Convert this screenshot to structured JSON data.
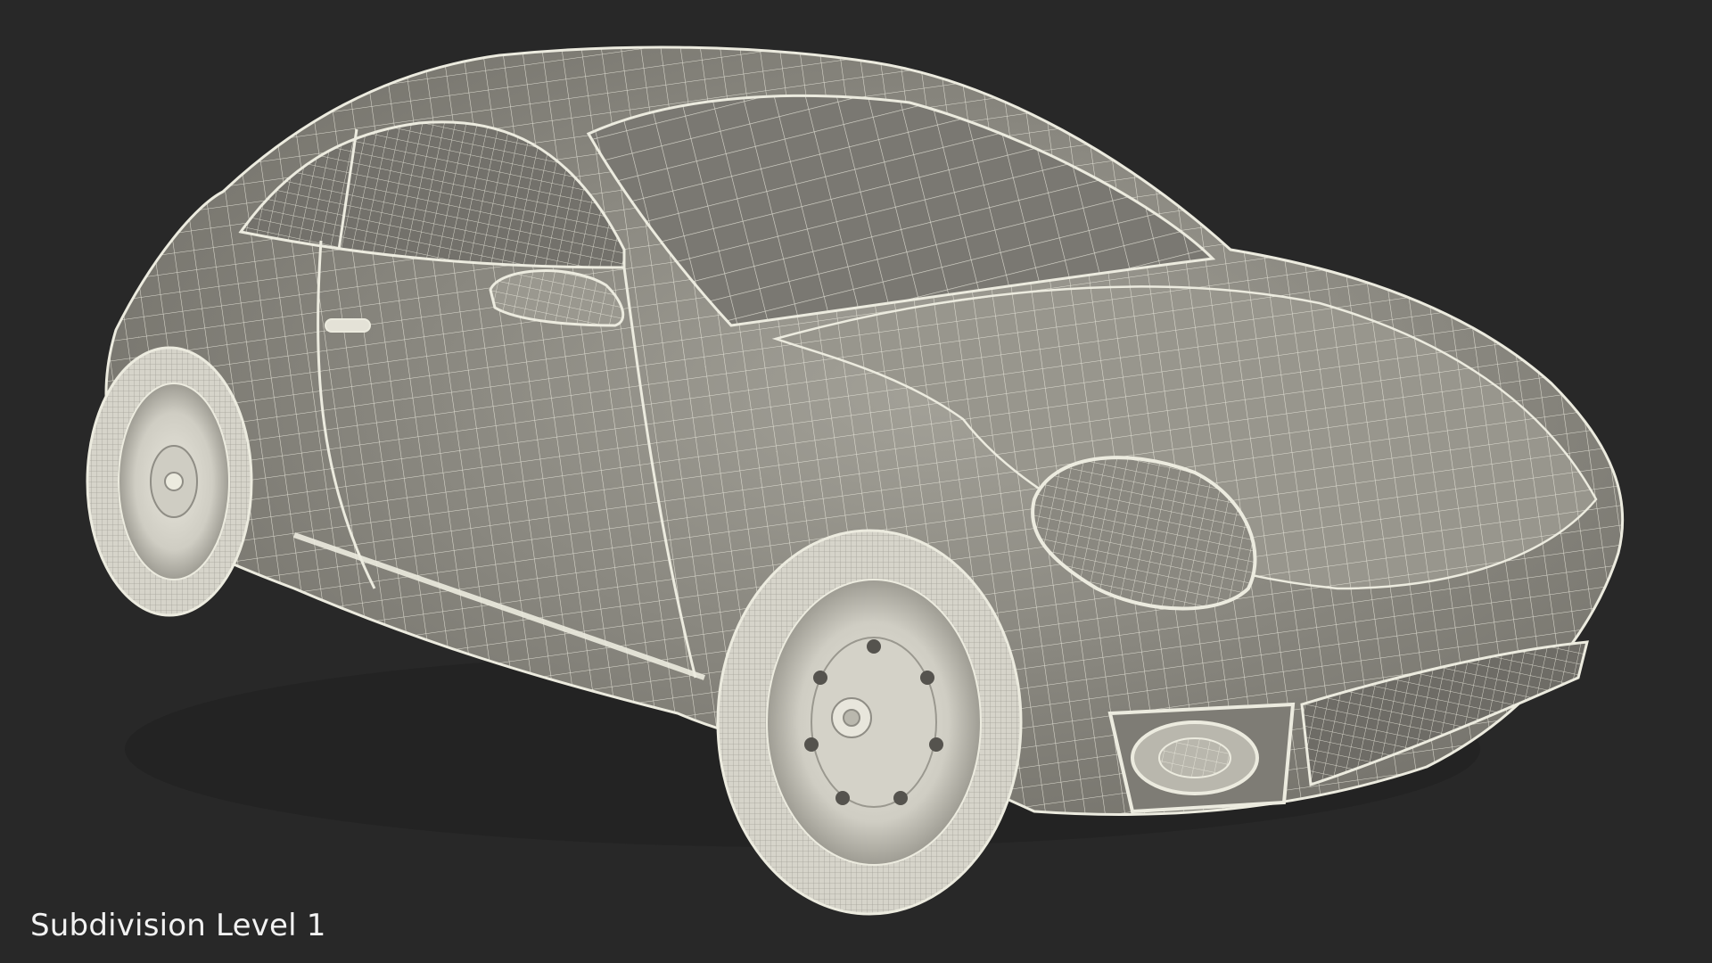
{
  "caption": "Subdivision Level 1",
  "colors": {
    "background": "#282828",
    "shell": "#8e8c83",
    "shell_light": "#a8a69c",
    "glass": "#6f6e69",
    "wire": "#ecebdf",
    "tire": "#c7c5bb",
    "caption": "#f2f2f2"
  }
}
